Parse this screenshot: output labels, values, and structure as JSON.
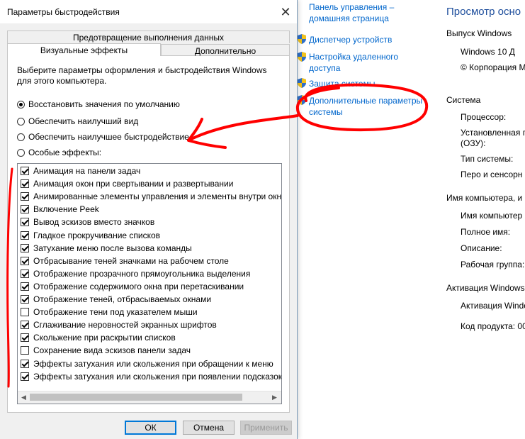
{
  "background": {
    "links": [
      {
        "label": "Панель управления – домашняя страница"
      },
      {
        "label": "Диспетчер устройств"
      },
      {
        "label": "Настройка удаленного доступа"
      },
      {
        "label": "Защита системы"
      },
      {
        "label": "Дополнительные параметры системы"
      }
    ],
    "title": "Просмотр осно",
    "edition_section": "Выпуск Windows",
    "edition_items": [
      "Windows 10 Д",
      "© Корпорация М"
    ],
    "system_section": "Система",
    "system_items": [
      "Процессор:",
      "Установленная п",
      "(ОЗУ):",
      "Тип системы:",
      "Перо и сенсорн"
    ],
    "name_section": "Имя компьютера, и",
    "name_items": [
      "Имя компьютер",
      "Полное имя:",
      "Описание:",
      "Рабочая группа:"
    ],
    "activation_section": "Активация Windows",
    "activation_items": [
      "Активация Windo",
      "Код продукта: 00"
    ]
  },
  "dialog": {
    "title": "Параметры быстродействия",
    "close_glyph": "✕",
    "tabs": {
      "dep": "Предотвращение выполнения данных",
      "visual": "Визуальные эффекты",
      "advanced": "Дополнительно"
    },
    "description": "Выберите параметры оформления и быстродействия Windows для этого компьютера.",
    "radios": [
      {
        "label": "Восстановить значения по умолчанию",
        "selected": true
      },
      {
        "label": "Обеспечить наилучший вид",
        "selected": false
      },
      {
        "label": "Обеспечить наилучшее быстродействие",
        "selected": false
      },
      {
        "label": "Особые эффекты:",
        "selected": false
      }
    ],
    "effects": [
      {
        "label": "Анимация на панели задач",
        "checked": true
      },
      {
        "label": "Анимация окон при свертывании и развертывании",
        "checked": true
      },
      {
        "label": "Анимированные элементы управления и элементы внутри окн",
        "checked": true
      },
      {
        "label": "Включение Peek",
        "checked": true
      },
      {
        "label": "Вывод эскизов вместо значков",
        "checked": true
      },
      {
        "label": "Гладкое прокручивание списков",
        "checked": true
      },
      {
        "label": "Затухание меню после вызова команды",
        "checked": true
      },
      {
        "label": "Отбрасывание теней значками на рабочем столе",
        "checked": true
      },
      {
        "label": "Отображение прозрачного прямоугольника выделения",
        "checked": true
      },
      {
        "label": "Отображение содержимого окна при перетаскивании",
        "checked": true
      },
      {
        "label": "Отображение теней, отбрасываемых окнами",
        "checked": true
      },
      {
        "label": "Отображение тени под указателем мыши",
        "checked": false
      },
      {
        "label": "Сглаживание неровностей экранных шрифтов",
        "checked": true
      },
      {
        "label": "Скольжение при раскрытии списков",
        "checked": true
      },
      {
        "label": "Сохранение вида эскизов панели задач",
        "checked": false
      },
      {
        "label": "Эффекты затухания или скольжения при обращении к меню",
        "checked": true
      },
      {
        "label": "Эффекты затухания или скольжения при появлении подсказок",
        "checked": true
      }
    ],
    "buttons": {
      "ok": "ОК",
      "cancel": "Отмена",
      "apply": "Применить"
    }
  },
  "colors": {
    "annotation": "#ff0000",
    "link": "#0066cc"
  }
}
